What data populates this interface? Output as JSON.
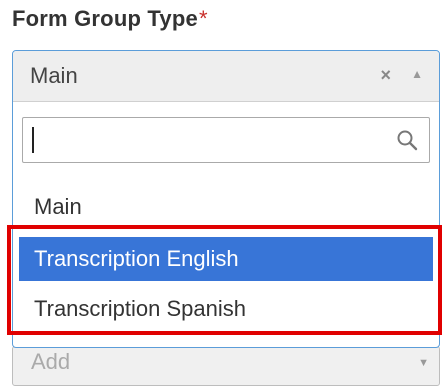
{
  "form": {
    "label": "Form Group Type",
    "required_mark": "*"
  },
  "select": {
    "selected_value": "Main",
    "clear_glyph": "×",
    "caret_glyph": "▲",
    "search_value": "",
    "search_icon": "search-icon",
    "options": [
      {
        "label": "Main",
        "highlighted": false
      },
      {
        "label": "Transcription English",
        "highlighted": true
      },
      {
        "label": "Transcription Spanish",
        "highlighted": false
      }
    ]
  },
  "second_select": {
    "value": "Add",
    "caret_glyph": "▼"
  },
  "colors": {
    "highlight": "#3875d7",
    "annotation_box": "#e00000",
    "required": "#c9302c"
  }
}
